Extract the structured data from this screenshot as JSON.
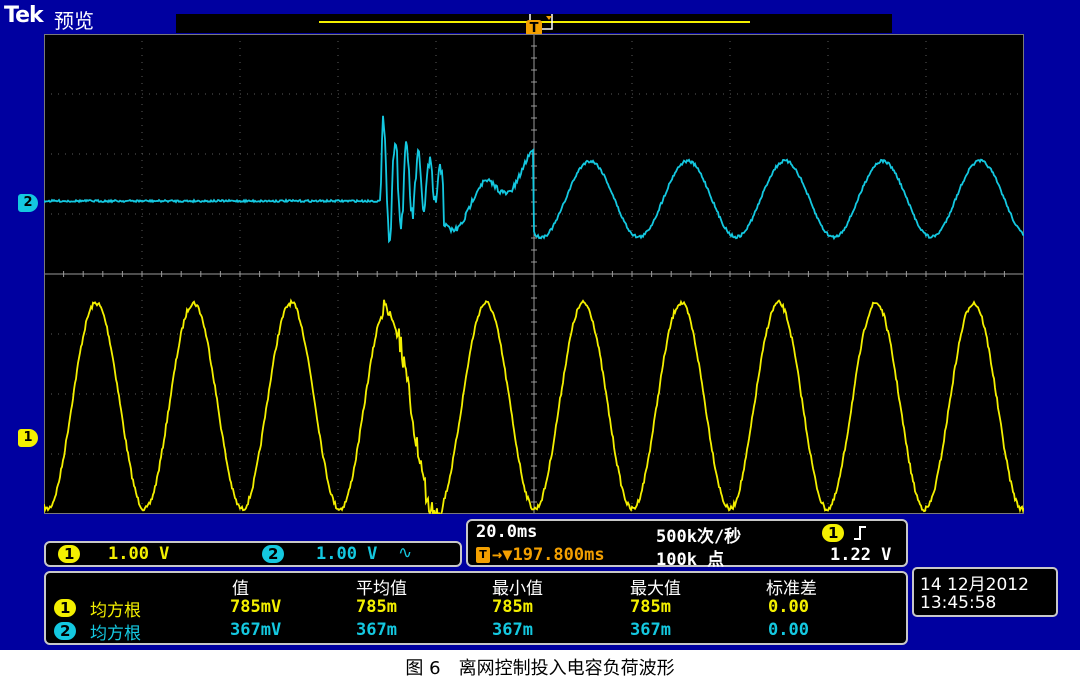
{
  "header": {
    "brand": "Tek",
    "mode": "预览"
  },
  "markers": {
    "trigger": "T",
    "ch2": "2",
    "ch1": "1"
  },
  "channels": {
    "ch1": {
      "badge": "1",
      "scale": "1.00 V",
      "color": "#f4f000"
    },
    "ch2": {
      "badge": "2",
      "scale": "1.00 V",
      "coupling_icon": "∿",
      "color": "#14c8e0"
    }
  },
  "timebase": {
    "horizontal_scale": "20.0ms",
    "sample_rate": "500k次/秒",
    "trigger_badge": "T",
    "trigger_position": "→▼197.800ms",
    "record_length": "100k 点",
    "trigger_source_badge": "1",
    "trigger_slope_icon": "rising-edge",
    "trigger_level": "1.22 V"
  },
  "measurements": {
    "headers": [
      "值",
      "平均值",
      "最小值",
      "最大值",
      "标准差"
    ],
    "rows": [
      {
        "badge": "1",
        "label": "均方根",
        "values": [
          "785mV",
          "785m",
          "785m",
          "785m",
          "0.00"
        ]
      },
      {
        "badge": "2",
        "label": "均方根",
        "values": [
          "367mV",
          "367m",
          "367m",
          "367m",
          "0.00"
        ]
      }
    ]
  },
  "datetime": {
    "date": "14 12月2012",
    "time": "13:45:58"
  },
  "caption": "图 6　离网控制投入电容负荷波形",
  "colors": {
    "frame": "#0000a0",
    "grid": "#5a5a5a",
    "ch1": "#f4f000",
    "ch2": "#14c8e0"
  }
}
